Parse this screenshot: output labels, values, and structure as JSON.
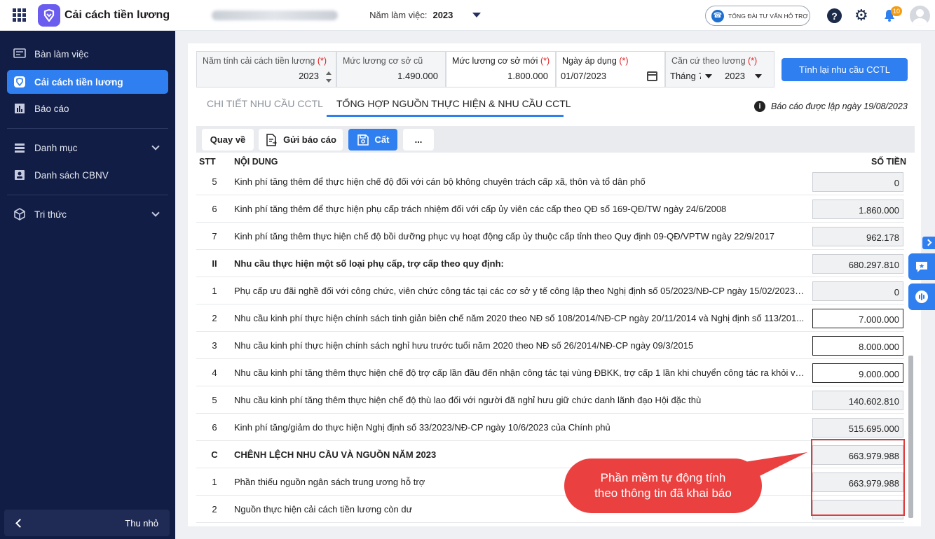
{
  "header": {
    "app_title": "Cải cách tiền lương",
    "year_label": "Năm làm việc:",
    "year_value": "2023",
    "hotline": "TỔNG ĐÀI TƯ VẤN HỖ TRỢ",
    "notification_count": "10",
    "help_symbol": "?"
  },
  "sidebar": {
    "items": [
      {
        "label": "Bàn làm việc",
        "icon": "dashboard-icon"
      },
      {
        "label": "Cải cách tiền lương",
        "icon": "app-logo-icon",
        "active": true
      },
      {
        "label": "Báo cáo",
        "icon": "bar-chart-icon"
      },
      {
        "label": "Danh mục",
        "icon": "list-icon",
        "expandable": true
      },
      {
        "label": "Danh sách CBNV",
        "icon": "id-card-icon"
      },
      {
        "label": "Tri thức",
        "icon": "cube-icon",
        "expandable": true
      }
    ],
    "collapse_label": "Thu nhỏ"
  },
  "form": {
    "reform_year_label": "Năm tính cải cách tiền lương",
    "reform_year_value": "2023",
    "old_base_label": "Mức lương cơ sở cũ",
    "old_base_value": "1.490.000",
    "new_base_label": "Mức lương cơ sở mới",
    "new_base_value": "1.800.000",
    "apply_date_label": "Ngày áp dụng",
    "apply_date_value": "01/07/2023",
    "basis_label": "Căn cứ theo lương",
    "basis_month": "Tháng 7",
    "basis_year": "2023",
    "required_mark": "(*)",
    "recalc_button": "Tính lại nhu cầu CCTL"
  },
  "tabs": [
    {
      "label": "CHI TIẾT NHU CẦU CCTL",
      "active": false
    },
    {
      "label": "TỔNG HỢP NGUỒN THỰC HIỆN & NHU CẦU CCTL",
      "active": true
    }
  ],
  "report_note": "Báo cáo được lập ngày 19/08/2023",
  "toolbar": {
    "back": "Quay về",
    "send": "Gửi báo cáo",
    "save": "Cất",
    "more": "..."
  },
  "table": {
    "headers": {
      "stt": "STT",
      "content": "NỘI DUNG",
      "amount": "SỐ TIỀN"
    },
    "rows": [
      {
        "stt": "5",
        "content": "Kinh phí tăng thêm để thực hiện chế độ đối với cán bộ không chuyên trách cấp xã, thôn và tổ dân phố",
        "amount": "0",
        "bold": false,
        "editable": false
      },
      {
        "stt": "6",
        "content": "Kinh phí tăng thêm để thực hiện phụ cấp trách nhiệm đối với cấp ủy viên các cấp theo QĐ số 169-QĐ/TW ngày 24/6/2008",
        "amount": "1.860.000",
        "bold": false,
        "editable": false
      },
      {
        "stt": "7",
        "content": "Kinh phí tăng thêm thực hiện chế độ bồi dưỡng phục vụ hoạt động cấp ủy thuộc cấp tỉnh theo Quy định 09-QĐ/VPTW ngày 22/9/2017",
        "amount": "962.178",
        "bold": false,
        "editable": false
      },
      {
        "stt": "II",
        "content": "Nhu cầu thực hiện một số loại phụ cấp, trợ cấp theo quy định:",
        "amount": "680.297.810",
        "bold": true,
        "editable": false
      },
      {
        "stt": "1",
        "content": "Phụ cấp ưu đãi nghề đối với công chức, viên chức công tác tại các cơ sở y tế công lập theo Nghị định số 05/2023/NĐ-CP ngày 15/02/2023 c...",
        "amount": "0",
        "bold": false,
        "editable": false
      },
      {
        "stt": "2",
        "content": "Nhu cầu kinh phí thực hiện chính sách tinh giản biên chế năm 2020 theo NĐ số 108/2014/NĐ-CP ngày 20/11/2014 và Nghị định số 113/201...",
        "amount": "7.000.000",
        "bold": false,
        "editable": true
      },
      {
        "stt": "3",
        "content": "Nhu cầu kinh phí thực hiện chính sách nghỉ hưu trước tuổi năm 2020 theo NĐ số 26/2014/NĐ-CP ngày 09/3/2015",
        "amount": "8.000.000",
        "bold": false,
        "editable": true
      },
      {
        "stt": "4",
        "content": "Nhu cầu kinh phí tăng thêm thực hiện chế độ trợ cấp lần đầu đến nhận công tác tại vùng ĐBKK, trợ cấp 1 lần khi chuyển công tác ra khỏi vùn...",
        "amount": "9.000.000",
        "bold": false,
        "editable": true
      },
      {
        "stt": "5",
        "content": "Nhu cầu kinh phí tăng thêm thực hiện chế độ thù lao đối với người đã nghỉ hưu giữ chức danh lãnh đạo Hội đặc thù",
        "amount": "140.602.810",
        "bold": false,
        "editable": false
      },
      {
        "stt": "6",
        "content": "Kinh phí tăng/giảm do thực hiện Nghị định số 33/2023/NĐ-CP ngày 10/6/2023 của Chính phủ",
        "amount": "515.695.000",
        "bold": false,
        "editable": false
      },
      {
        "stt": "C",
        "content": "CHÊNH LỆCH NHU CẦU VÀ NGUỒN NĂM 2023",
        "amount": "663.979.988",
        "bold": true,
        "editable": false
      },
      {
        "stt": "1",
        "content": "Phần thiếu nguồn ngân sách trung ương hỗ trợ",
        "amount": "663.979.988",
        "bold": false,
        "editable": false
      },
      {
        "stt": "2",
        "content": "Nguồn thực hiện cải cách tiền lương còn dư",
        "amount": "",
        "bold": false,
        "editable": false
      }
    ]
  },
  "callout": {
    "line1": "Phần mềm tự động tính",
    "line2": "theo thông tin đã khai báo",
    "color": "#ea4040"
  },
  "colors": {
    "primary": "#2f7ff0",
    "sidebar": "#111d45",
    "highlight": "#e03c3c"
  }
}
